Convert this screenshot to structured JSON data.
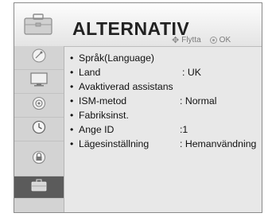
{
  "header": {
    "title": "ALTERNATIV",
    "hint_move": "Flytta",
    "hint_ok": "OK"
  },
  "sidebar": {
    "items": [
      {
        "icon": "satellite-dish-icon"
      },
      {
        "icon": "monitor-icon"
      },
      {
        "icon": "audio-icon"
      },
      {
        "icon": "clock-icon"
      },
      {
        "icon": "lock-icon"
      },
      {
        "icon": "option-briefcase-icon",
        "active": true
      }
    ]
  },
  "menu": {
    "items": [
      {
        "label": "Språk(Language)",
        "value": ""
      },
      {
        "label": "Land",
        "value": ": UK"
      },
      {
        "label": "Avaktiverad assistans",
        "value": ""
      },
      {
        "label": "ISM-metod",
        "value": ": Normal"
      },
      {
        "label": "Fabriksinst.",
        "value": ""
      },
      {
        "label": "Ange ID",
        "value": ":1"
      },
      {
        "label": "Lägesinställning",
        "value": ": Hemanvändning"
      }
    ]
  },
  "colors": {
    "active_sidebar": "#5b5b5b",
    "panel_bg": "#e8e8e8"
  }
}
